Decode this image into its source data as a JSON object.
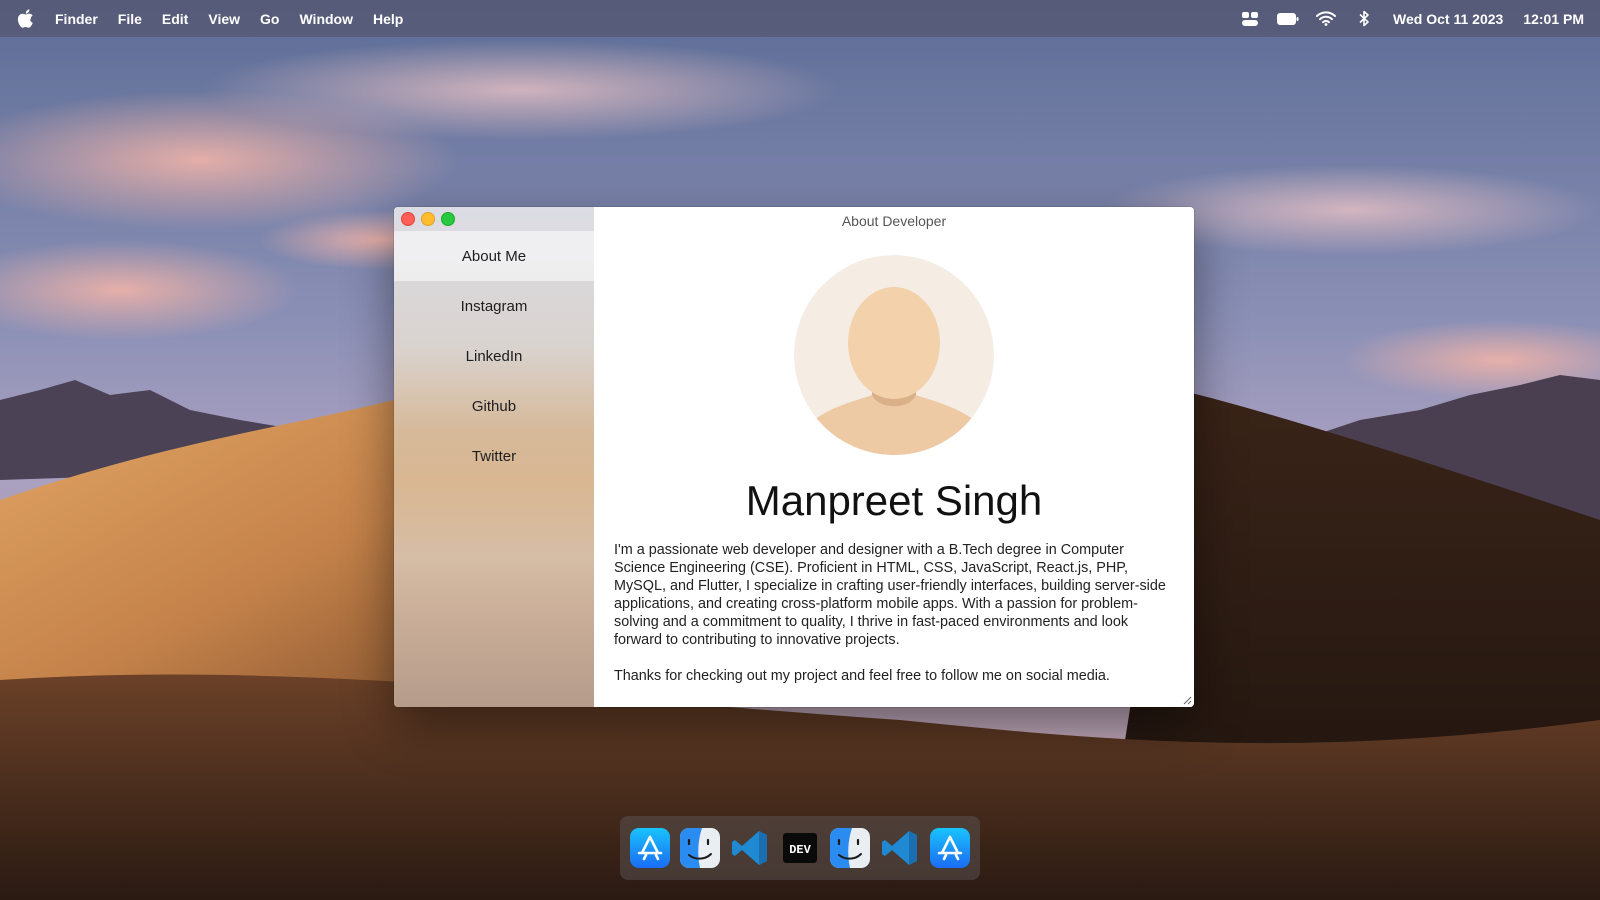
{
  "menubar": {
    "app_name": "Finder",
    "menus": [
      "File",
      "Edit",
      "View",
      "Go",
      "Window",
      "Help"
    ],
    "status_icons": [
      "control-center-icon",
      "battery-icon",
      "wifi-icon",
      "bluetooth-icon"
    ],
    "date": "Wed Oct 11 2023",
    "time": "12:01 PM"
  },
  "window": {
    "title": "About Developer",
    "sidebar": {
      "items": [
        {
          "label": "About Me",
          "active": true
        },
        {
          "label": "Instagram",
          "active": false
        },
        {
          "label": "LinkedIn",
          "active": false
        },
        {
          "label": "Github",
          "active": false
        },
        {
          "label": "Twitter",
          "active": false
        }
      ]
    },
    "profile": {
      "name": "Manpreet Singh",
      "bio_paragraphs": [
        "I'm a passionate web developer and designer with a B.Tech degree in Computer Science Engineering (CSE). Proficient in HTML, CSS, JavaScript, React.js, PHP, MySQL, and Flutter, I specialize in crafting user-friendly interfaces, building server-side applications, and creating cross-platform mobile apps. With a passion for problem-solving and a commitment to quality, I thrive in fast-paced environments and look forward to contributing to innovative projects.",
        "Thanks for checking out my project and feel free to follow me on social media."
      ]
    }
  },
  "dock": {
    "apps": [
      {
        "icon": "app-store-icon"
      },
      {
        "icon": "finder-icon"
      },
      {
        "icon": "vscode-icon"
      },
      {
        "icon": "dev-icon",
        "label": "DEV"
      },
      {
        "icon": "finder-icon"
      },
      {
        "icon": "vscode-icon"
      },
      {
        "icon": "app-store-icon"
      }
    ]
  },
  "colors": {
    "close": "#fe5f57",
    "minimize": "#febc2e",
    "zoom": "#28c840",
    "appstore": "#1a8cf5",
    "vscode": "#1f8ad2"
  }
}
